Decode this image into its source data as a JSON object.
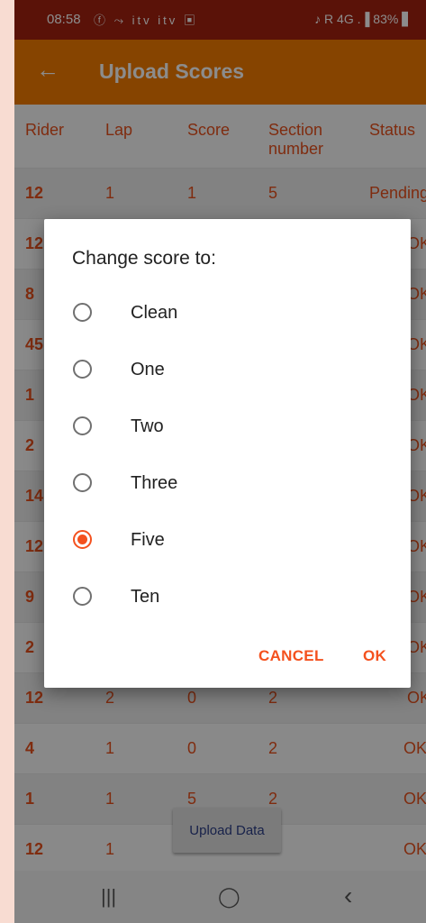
{
  "status_bar": {
    "time": "08:58",
    "left_icons": "ⓕ ⤳ itv itv ▣",
    "right_icons": "♪ R 4G .▐ 83% ▋"
  },
  "app_bar": {
    "back_icon": "arrow-left",
    "title": "Upload Scores"
  },
  "table": {
    "headers": [
      "Rider",
      "Lap",
      "Score",
      "Section number",
      "Status"
    ],
    "rows": [
      [
        "12",
        "1",
        "1",
        "5",
        "Pending"
      ],
      [
        "12",
        "",
        "",
        "",
        "OK"
      ],
      [
        "8",
        "",
        "",
        "",
        "OK"
      ],
      [
        "45",
        "",
        "",
        "",
        "OK"
      ],
      [
        "1",
        "",
        "",
        "",
        "OK"
      ],
      [
        "2",
        "",
        "",
        "",
        "OK"
      ],
      [
        "14",
        "",
        "",
        "",
        "OK"
      ],
      [
        "12",
        "",
        "",
        "",
        "OK"
      ],
      [
        "9",
        "",
        "",
        "",
        "OK"
      ],
      [
        "2",
        "",
        "",
        "",
        "OK"
      ],
      [
        "12",
        "2",
        "0",
        "2",
        "OK"
      ],
      [
        "4",
        "1",
        "0",
        "2",
        "OK"
      ],
      [
        "1",
        "1",
        "5",
        "2",
        "OK"
      ],
      [
        "12",
        "1",
        "",
        "",
        "OK"
      ]
    ]
  },
  "upload_button": "Upload Data",
  "dialog": {
    "title": "Change score to:",
    "options": [
      "Clean",
      "One",
      "Two",
      "Three",
      "Five",
      "Ten"
    ],
    "selected": "Five",
    "cancel": "CANCEL",
    "ok": "OK"
  },
  "nav_bar": {
    "recents": "|||",
    "home": "◯",
    "back": "‹"
  },
  "colors": {
    "status_bar": "#a4210f",
    "app_bar": "#f57c00",
    "accent": "#f4511e",
    "table_text": "#e8501d"
  }
}
